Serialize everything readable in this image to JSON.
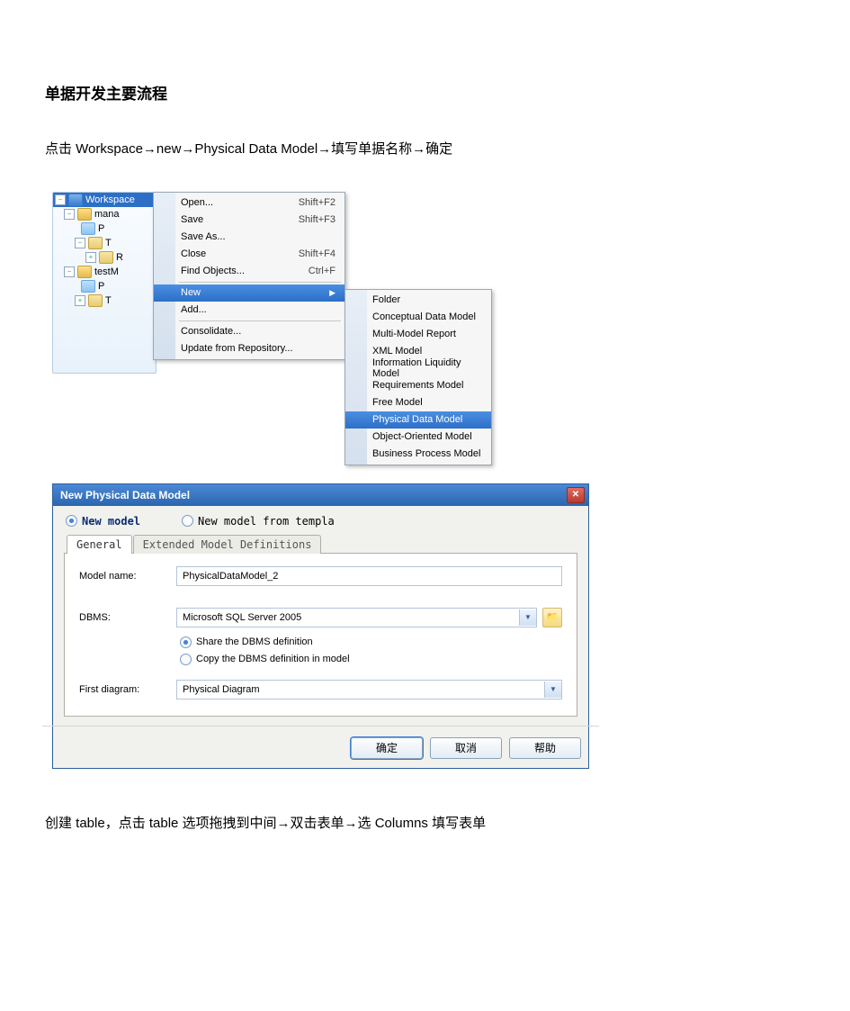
{
  "heading": "单据开发主要流程",
  "step1": "点击 Workspace→new→Physical  Data  Model→填写单据名称→确定",
  "step2": "创建 table，点击 table 选项拖拽到中间→双击表单→选 Columns 填写表单",
  "tree": {
    "n0": "Workspace",
    "n1": "mana",
    "n2": "P",
    "n3": "T",
    "n4": "R",
    "n5": "testM",
    "n6": "P",
    "n7": "T"
  },
  "menu1": {
    "open": {
      "label": "Open...",
      "shortcut": "Shift+F2"
    },
    "save": {
      "label": "Save",
      "shortcut": "Shift+F3"
    },
    "saveas": {
      "label": "Save As...",
      "shortcut": ""
    },
    "close": {
      "label": "Close",
      "shortcut": "Shift+F4"
    },
    "find": {
      "label": "Find Objects...",
      "shortcut": "Ctrl+F"
    },
    "newitem": {
      "label": "New",
      "shortcut": ""
    },
    "add": {
      "label": "Add...",
      "shortcut": ""
    },
    "consolidate": {
      "label": "Consolidate...",
      "shortcut": ""
    },
    "update": {
      "label": "Update from Repository...",
      "shortcut": ""
    }
  },
  "menu2": {
    "folder": "Folder",
    "cdm": "Conceptual Data Model",
    "mmr": "Multi-Model Report",
    "xml": "XML Model",
    "ilm": "Information Liquidity Model",
    "rm": "Requirements Model",
    "fm": "Free Model",
    "pdm": "Physical Data Model",
    "oom": "Object-Oriented Model",
    "bpm": "Business Process Model"
  },
  "dialog": {
    "title": "New Physical Data Model",
    "radioNew": "New model",
    "radioTpl": "New model from templa",
    "tabGeneral": "General",
    "tabExt": "Extended Model Definitions",
    "lblModel": "Model name:",
    "valModel": "PhysicalDataModel_2",
    "lblDBMS": "DBMS:",
    "valDBMS": "Microsoft SQL Server 2005",
    "optShare": "Share the DBMS definition",
    "optCopy": "Copy the DBMS definition in model",
    "lblDiagram": "First diagram:",
    "valDiagram": "Physical Diagram",
    "btnOK": "确定",
    "btnCancel": "取消",
    "btnHelp": "帮助"
  }
}
